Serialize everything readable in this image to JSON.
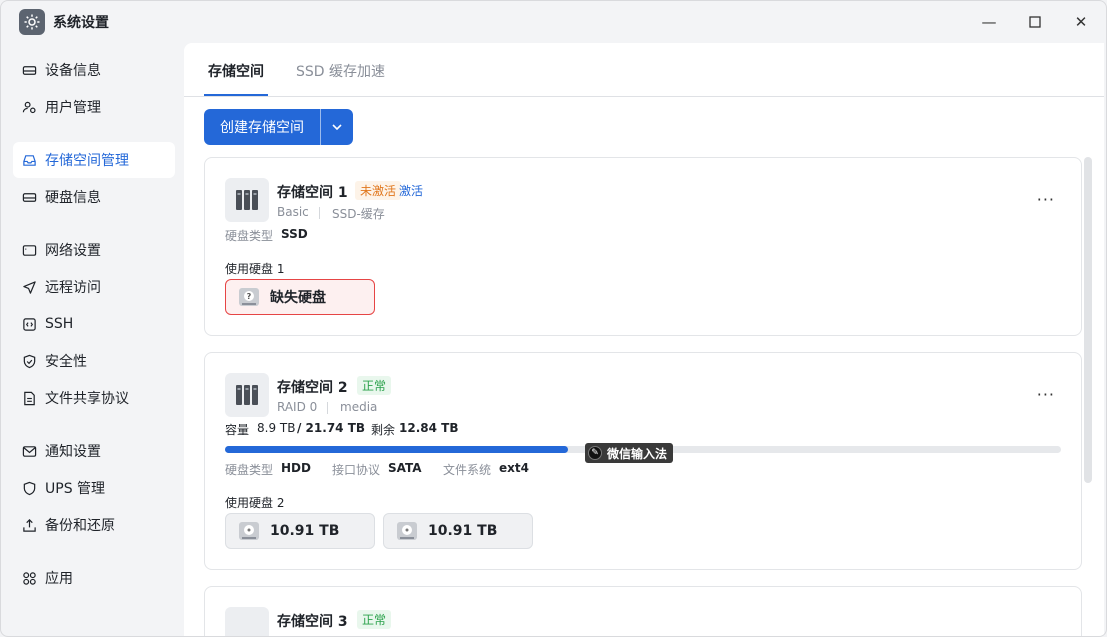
{
  "window": {
    "title": "系统设置",
    "minimize": "—",
    "maximize": "☐",
    "close": "✕"
  },
  "sidebar": {
    "items": [
      {
        "label": "设备信息",
        "icon": "hard-drive-icon"
      },
      {
        "label": "用户管理",
        "icon": "users-icon"
      },
      {
        "label": "存储空间管理",
        "icon": "storage-icon",
        "active": true
      },
      {
        "label": "硬盘信息",
        "icon": "disk-icon"
      },
      {
        "label": "网络设置",
        "icon": "monitor-icon"
      },
      {
        "label": "远程访问",
        "icon": "send-icon"
      },
      {
        "label": "SSH",
        "icon": "terminal-icon"
      },
      {
        "label": "安全性",
        "icon": "shield-icon"
      },
      {
        "label": "文件共享协议",
        "icon": "document-icon"
      },
      {
        "label": "通知设置",
        "icon": "mail-icon"
      },
      {
        "label": "UPS 管理",
        "icon": "ups-shield-icon"
      },
      {
        "label": "备份和还原",
        "icon": "backup-icon"
      },
      {
        "label": "应用",
        "icon": "apps-icon"
      }
    ]
  },
  "tabs": [
    {
      "label": "存储空间",
      "active": true
    },
    {
      "label": "SSD 缓存加速",
      "active": false
    }
  ],
  "create_button": {
    "label": "创建存储空间"
  },
  "pools": [
    {
      "name": "存储空间 1",
      "status": "未激活",
      "action": "激活",
      "raid": "Basic",
      "usage": "SSD-缓存",
      "disk_type_label": "硬盘类型",
      "disk_type": "SSD",
      "disks_label": "使用硬盘 1",
      "disks": [
        {
          "label": "缺失硬盘",
          "state": "missing"
        }
      ]
    },
    {
      "name": "存储空间 2",
      "status": "正常",
      "raid": "RAID 0",
      "usage": "media",
      "capacity_label": "容量",
      "used": "8.9 TB",
      "total": "/ 21.74 TB",
      "free_label": "剩余",
      "free": "12.84 TB",
      "usage_fraction": 0.41,
      "disk_type_label": "硬盘类型",
      "disk_type": "HDD",
      "interface_label": "接口协议",
      "interface": "SATA",
      "fs_label": "文件系统",
      "fs": "ext4",
      "disks_label": "使用硬盘 2",
      "disks": [
        {
          "label": "10.91 TB"
        },
        {
          "label": "10.91 TB"
        }
      ]
    },
    {
      "name": "存储空间 3",
      "status": "正常"
    }
  ],
  "ime": {
    "label": "微信输入法"
  },
  "colors": {
    "accent": "#2468d8",
    "warn": "#e0761c",
    "ok": "#2ba24c",
    "danger": "#e64545"
  }
}
